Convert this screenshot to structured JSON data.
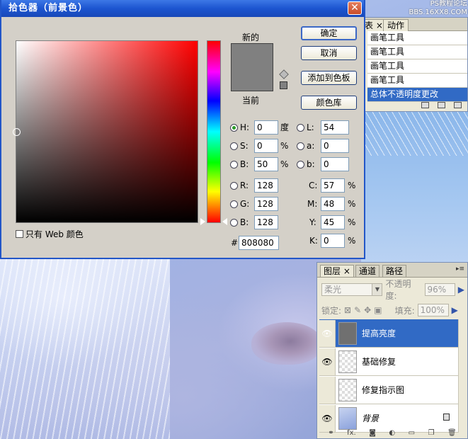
{
  "watermark": {
    "line1": "PS教程论坛",
    "line2": "BBS.16XX8.COM"
  },
  "actions_panel": {
    "tab_history_suffix": "表",
    "tab_actions": "动作",
    "rows": [
      "画笔工具",
      "画笔工具",
      "画笔工具",
      "画笔工具",
      "总体不透明度更改"
    ],
    "selected_row": 4
  },
  "dialog": {
    "title": "拾色器（前景色）",
    "label_new": "新的",
    "label_current": "当前",
    "new_color": "#808080",
    "current_color": "#808080",
    "web_only_label": "只有 Web 颜色",
    "buttons": {
      "ok": "确定",
      "cancel": "取消",
      "add_swatch": "添加到色板",
      "libraries": "颜色库"
    },
    "hsb": {
      "h": {
        "label": "H:",
        "value": "0",
        "unit": "度",
        "selected": true
      },
      "s": {
        "label": "S:",
        "value": "0",
        "unit": "%"
      },
      "b": {
        "label": "B:",
        "value": "50",
        "unit": "%"
      }
    },
    "rgb": {
      "r": {
        "label": "R:",
        "value": "128"
      },
      "g": {
        "label": "G:",
        "value": "128"
      },
      "b": {
        "label": "B:",
        "value": "128"
      }
    },
    "lab": {
      "l": {
        "label": "L:",
        "value": "54"
      },
      "a": {
        "label": "a:",
        "value": "0"
      },
      "b": {
        "label": "b:",
        "value": "0"
      }
    },
    "cmyk": {
      "c": {
        "label": "C:",
        "value": "57",
        "unit": "%"
      },
      "m": {
        "label": "M:",
        "value": "48",
        "unit": "%"
      },
      "y": {
        "label": "Y:",
        "value": "45",
        "unit": "%"
      },
      "k": {
        "label": "K:",
        "value": "0",
        "unit": "%"
      }
    },
    "hex": {
      "label": "#",
      "value": "808080"
    }
  },
  "layers_panel": {
    "tabs": [
      "图层",
      "通道",
      "路径"
    ],
    "active_tab": 0,
    "blend_mode": "柔光",
    "opacity_label": "不透明度:",
    "opacity_value": "96%",
    "lock_label": "锁定:",
    "fill_label": "填充:",
    "fill_value": "100%",
    "layers": [
      {
        "name": "提高亮度",
        "visible": true,
        "selected": true
      },
      {
        "name": "基础修复",
        "visible": true
      },
      {
        "name": "修复指示图",
        "visible": false
      },
      {
        "name": "背景",
        "visible": true,
        "locked": true
      }
    ],
    "footer_fx": "fx."
  },
  "colors": {
    "accent": "#316ac5",
    "titlebar": "#1c55d0"
  }
}
